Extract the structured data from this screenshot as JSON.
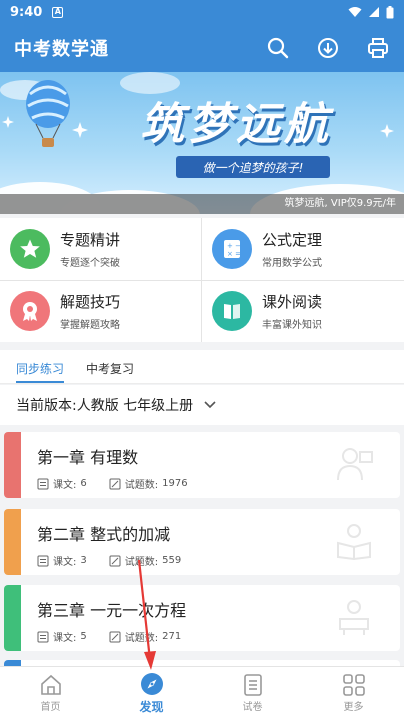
{
  "status_bar": {
    "time": "9:40",
    "notification_icon": "A"
  },
  "app_bar": {
    "title": "中考数学通"
  },
  "banner": {
    "headline": "筑梦远航",
    "tagline": "做一个追梦的孩子!",
    "caption": "筑梦远航, VIP仅9.9元/年"
  },
  "features": [
    {
      "title": "专题精讲",
      "subtitle": "专题逐个突破",
      "icon": "star-icon",
      "color": "#4cbb5f"
    },
    {
      "title": "公式定理",
      "subtitle": "常用数学公式",
      "icon": "calculator-icon",
      "color": "#4a9be8"
    },
    {
      "title": "解题技巧",
      "subtitle": "掌握解题攻略",
      "icon": "badge-icon",
      "color": "#f0767a"
    },
    {
      "title": "课外阅读",
      "subtitle": "丰富课外知识",
      "icon": "book-icon",
      "color": "#2cb8a2"
    }
  ],
  "tabs": [
    {
      "label": "同步练习",
      "active": true
    },
    {
      "label": "中考复习",
      "active": false
    }
  ],
  "version": {
    "label": "当前版本:",
    "value": "人教版 七年级上册"
  },
  "chapters": [
    {
      "name": "第一章 有理数",
      "lessons_label": "课文:",
      "lessons": "6",
      "questions_label": "试题数:",
      "questions": "1976",
      "color": "#e8736f"
    },
    {
      "name": "第二章 整式的加减",
      "lessons_label": "课文:",
      "lessons": "3",
      "questions_label": "试题数:",
      "questions": "559",
      "color": "#f0a04d"
    },
    {
      "name": "第三章 一元一次方程",
      "lessons_label": "课文:",
      "lessons": "5",
      "questions_label": "试题数:",
      "questions": "271",
      "color": "#3fbf7a"
    }
  ],
  "bottom_nav": [
    {
      "label": "首页",
      "icon": "home-icon",
      "active": false
    },
    {
      "label": "发现",
      "icon": "compass-icon",
      "active": true
    },
    {
      "label": "试卷",
      "icon": "paper-icon",
      "active": false
    },
    {
      "label": "更多",
      "icon": "grid-icon",
      "active": false
    }
  ],
  "colors": {
    "primary": "#3a8ad6",
    "annotation_arrow": "#e53935"
  }
}
